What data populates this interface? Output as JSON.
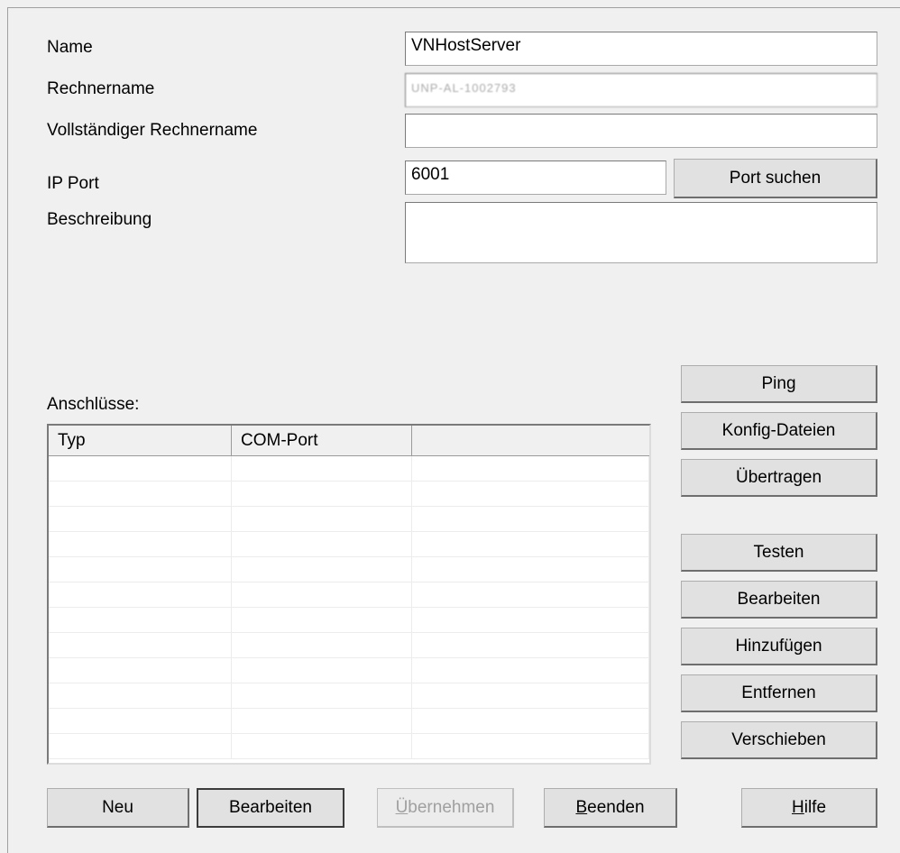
{
  "form": {
    "name_label": "Name",
    "name_value": "VNHostServer",
    "computer_label": "Rechnername",
    "computer_value": "UNP-AL-1002793",
    "full_computer_label": "Vollständiger Rechnername",
    "full_computer_value": "",
    "port_label": "IP Port",
    "port_value": "6001",
    "port_search_button": "Port suchen",
    "description_label": "Beschreibung",
    "description_value": ""
  },
  "connections": {
    "label": "Anschlüsse:",
    "columns": [
      "Typ",
      "COM-Port",
      ""
    ],
    "row_count": 12
  },
  "side_buttons": {
    "ping": "Ping",
    "config_files": "Konfig-Dateien",
    "transfer": "Übertragen",
    "test": "Testen",
    "edit": "Bearbeiten",
    "add": "Hinzufügen",
    "remove": "Entfernen",
    "move": "Verschieben"
  },
  "bottom_buttons": {
    "new": "Neu",
    "edit": "Bearbeiten",
    "apply_underlined": "Ü",
    "apply_rest": "bernehmen",
    "apply_disabled": true,
    "exit_underlined": "B",
    "exit_rest": "eenden",
    "help_underlined": "H",
    "help_rest": "ilfe"
  }
}
